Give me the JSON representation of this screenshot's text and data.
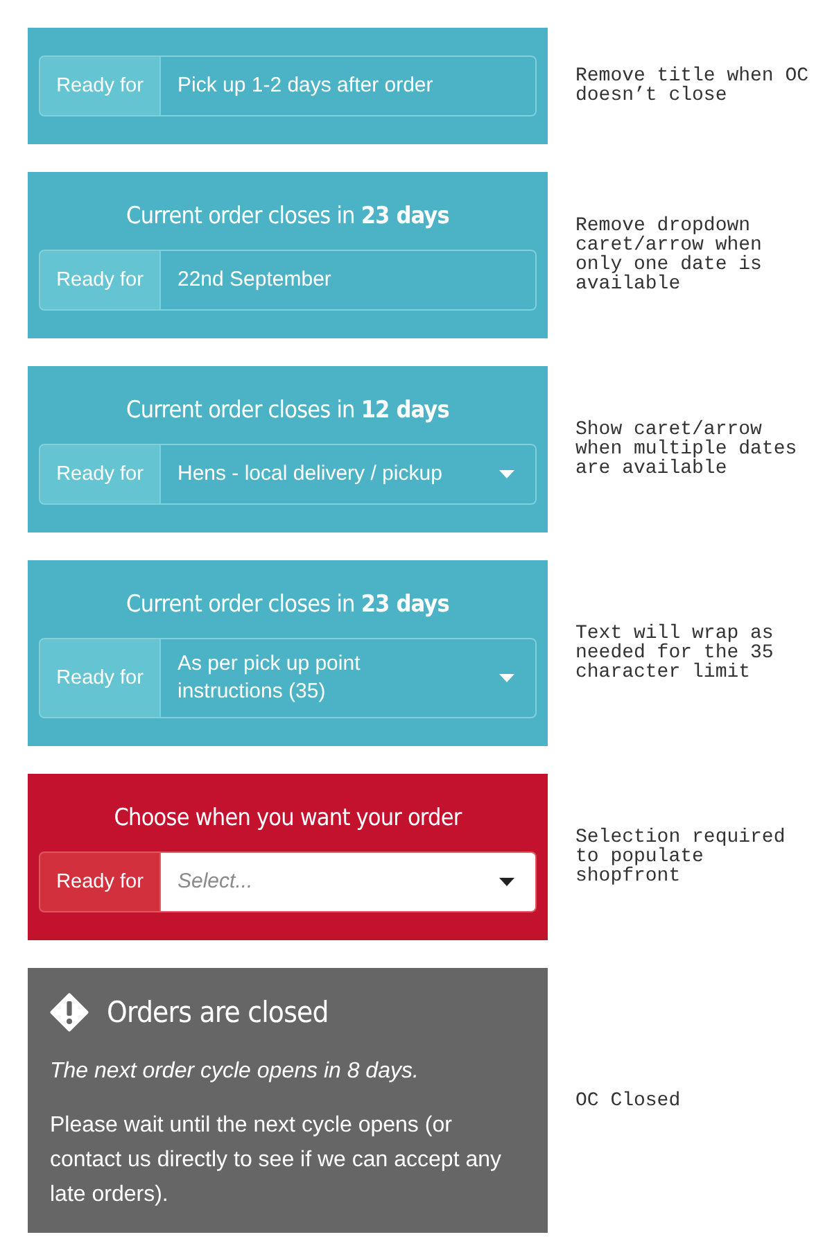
{
  "panels": [
    {
      "kind": "select",
      "required": false,
      "label": "Ready for",
      "value": "Pick up 1-2 days after order",
      "caret": false,
      "note": "Remove title when OC doesn’t close"
    },
    {
      "kind": "select",
      "required": false,
      "title": "Current order closes in **23 days**",
      "label": "Ready for",
      "value": "22nd September",
      "caret": false,
      "note": "Remove dropdown caret/arrow when only one date is available"
    },
    {
      "kind": "select",
      "required": false,
      "title": "Current order closes in **12 days**",
      "label": "Ready for",
      "value": "Hens - local delivery / pickup",
      "caret": true,
      "note": "Show caret/arrow when multiple dates are available"
    },
    {
      "kind": "select",
      "required": false,
      "title": "Current order closes in **23 days**",
      "label": "Ready for",
      "value": "As per pick up point instructions (35)",
      "caret": true,
      "note": "Text will wrap as needed for the 35 character limit"
    },
    {
      "kind": "select",
      "required": true,
      "title": "Choose when you want your order",
      "label": "Ready for",
      "placeholder": "Select...",
      "caret": true,
      "note": "Selection required to populate shopfront"
    },
    {
      "kind": "closed",
      "title": "Orders are closed",
      "subtitle": "The next order cycle opens in 8 days.",
      "message": "Please wait until the next cycle opens (or contact us directly to see if we can accept any late orders).",
      "note": "OC Closed"
    }
  ]
}
